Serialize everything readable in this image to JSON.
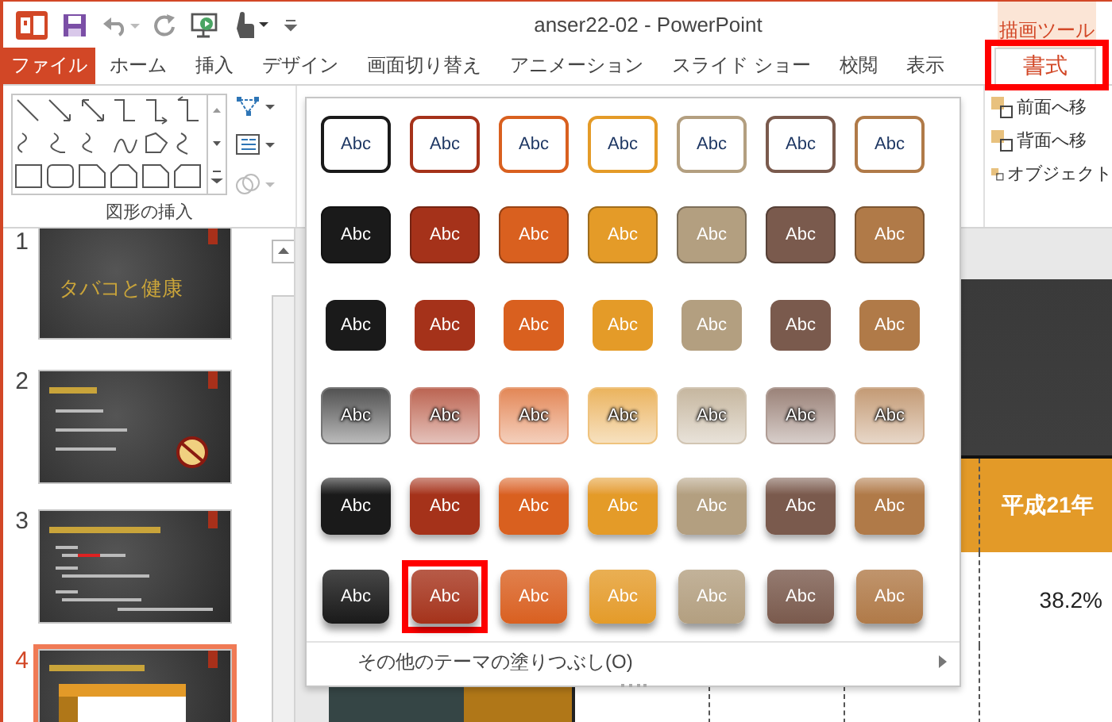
{
  "window": {
    "title": "anser22-02 - PowerPoint",
    "context_group": "描画ツール"
  },
  "tabs": [
    {
      "label": "ファイル",
      "kind": "file",
      "selected": false,
      "annotated": false
    },
    {
      "label": "ホーム",
      "kind": "normal",
      "selected": false,
      "annotated": false
    },
    {
      "label": "挿入",
      "kind": "normal",
      "selected": false,
      "annotated": false
    },
    {
      "label": "デザイン",
      "kind": "normal",
      "selected": false,
      "annotated": false
    },
    {
      "label": "画面切り替え",
      "kind": "normal",
      "selected": false,
      "annotated": false
    },
    {
      "label": "アニメーション",
      "kind": "normal",
      "selected": false,
      "annotated": false
    },
    {
      "label": "スライド ショー",
      "kind": "normal",
      "selected": false,
      "annotated": false
    },
    {
      "label": "校閲",
      "kind": "normal",
      "selected": false,
      "annotated": false
    },
    {
      "label": "表示",
      "kind": "normal",
      "selected": false,
      "annotated": false
    },
    {
      "label": "書式",
      "kind": "context",
      "selected": true,
      "annotated": true
    }
  ],
  "ribbon": {
    "group_label": "図形の挿入",
    "arrange_buttons": [
      {
        "label": "前面へ移"
      },
      {
        "label": "背面へ移"
      },
      {
        "label": "オブジェクト"
      }
    ]
  },
  "slides": [
    {
      "number": "1",
      "title": "タバコと健康",
      "kind": "title",
      "selected": false
    },
    {
      "number": "2",
      "kind": "bullets",
      "selected": false
    },
    {
      "number": "3",
      "kind": "text",
      "selected": false
    },
    {
      "number": "4",
      "kind": "table",
      "selected": true
    }
  ],
  "gallery": {
    "rows": [
      {
        "kind": "outline",
        "swatches": [
          {
            "label": "Abc",
            "annotated": false
          },
          {
            "label": "Abc",
            "annotated": false
          },
          {
            "label": "Abc",
            "annotated": false
          },
          {
            "label": "Abc",
            "annotated": false
          },
          {
            "label": "Abc",
            "annotated": false
          },
          {
            "label": "Abc",
            "annotated": false
          },
          {
            "label": "Abc",
            "annotated": false
          }
        ]
      },
      {
        "kind": "solid",
        "swatches": [
          {
            "label": "Abc",
            "annotated": false
          },
          {
            "label": "Abc",
            "annotated": false
          },
          {
            "label": "Abc",
            "annotated": false
          },
          {
            "label": "Abc",
            "annotated": false
          },
          {
            "label": "Abc",
            "annotated": false
          },
          {
            "label": "Abc",
            "annotated": false
          },
          {
            "label": "Abc",
            "annotated": false
          }
        ]
      },
      {
        "kind": "plain",
        "swatches": [
          {
            "label": "Abc",
            "annotated": false
          },
          {
            "label": "Abc",
            "annotated": false
          },
          {
            "label": "Abc",
            "annotated": false
          },
          {
            "label": "Abc",
            "annotated": false
          },
          {
            "label": "Abc",
            "annotated": false
          },
          {
            "label": "Abc",
            "annotated": false
          },
          {
            "label": "Abc",
            "annotated": false
          }
        ]
      },
      {
        "kind": "light",
        "swatches": [
          {
            "label": "Abc",
            "annotated": false
          },
          {
            "label": "Abc",
            "annotated": false
          },
          {
            "label": "Abc",
            "annotated": false
          },
          {
            "label": "Abc",
            "annotated": false
          },
          {
            "label": "Abc",
            "annotated": false
          },
          {
            "label": "Abc",
            "annotated": false
          },
          {
            "label": "Abc",
            "annotated": false
          }
        ]
      },
      {
        "kind": "moderate",
        "swatches": [
          {
            "label": "Abc",
            "annotated": false
          },
          {
            "label": "Abc",
            "annotated": false
          },
          {
            "label": "Abc",
            "annotated": false
          },
          {
            "label": "Abc",
            "annotated": false
          },
          {
            "label": "Abc",
            "annotated": false
          },
          {
            "label": "Abc",
            "annotated": false
          },
          {
            "label": "Abc",
            "annotated": false
          }
        ]
      },
      {
        "kind": "intense",
        "swatches": [
          {
            "label": "Abc",
            "annotated": false
          },
          {
            "label": "Abc",
            "annotated": true
          },
          {
            "label": "Abc",
            "annotated": false
          },
          {
            "label": "Abc",
            "annotated": false
          },
          {
            "label": "Abc",
            "annotated": false
          },
          {
            "label": "Abc",
            "annotated": false
          },
          {
            "label": "Abc",
            "annotated": false
          }
        ]
      }
    ],
    "more_item": "その他のテーマの塗りつぶし(O)"
  },
  "slide_table": {
    "header": "平成21年",
    "value": "38.2%"
  }
}
